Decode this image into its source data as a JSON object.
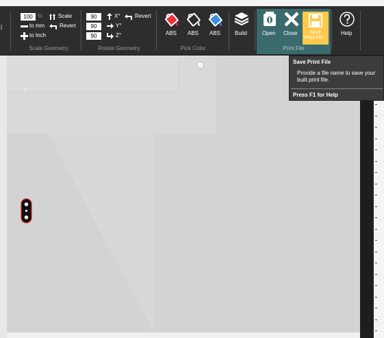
{
  "ribbon": {
    "scale_geometry": {
      "scale_value": "100",
      "percent_symbol": "%",
      "scale_label": "Scale",
      "to_mm_label": "to mm",
      "revert_label": "Revert",
      "to_inch_label": "to Inch",
      "group_caption": "Scale Geometry"
    },
    "rotate_geometry": {
      "x_value": "90",
      "y_value": "90",
      "z_value": "90",
      "x_label": "X°",
      "y_label": "Y°",
      "z_label": "Z°",
      "revert_label": "Revert",
      "group_caption": "Rotate Geometry"
    },
    "pick_color": {
      "items": [
        {
          "label": "ABS",
          "color": "#e8363a"
        },
        {
          "label": "ABS",
          "color": "#ffffff"
        },
        {
          "label": "ABS",
          "color": "#3a8ee6"
        }
      ],
      "group_caption": "Pick Color"
    },
    "build_label": "Build",
    "print_file": {
      "open_label": "Open",
      "close_label": "Close",
      "save_label_line1": "Save",
      "save_label_line2": "Print File",
      "group_caption": "Print File",
      "group_color": "#3a6a6e",
      "save_active_color": "#ffc94a"
    },
    "help_label": "Help"
  },
  "tooltip": {
    "title": "Save Print File",
    "body": "Provide a file name to save your built print file.",
    "help_hint": "Press F1 for Help"
  }
}
